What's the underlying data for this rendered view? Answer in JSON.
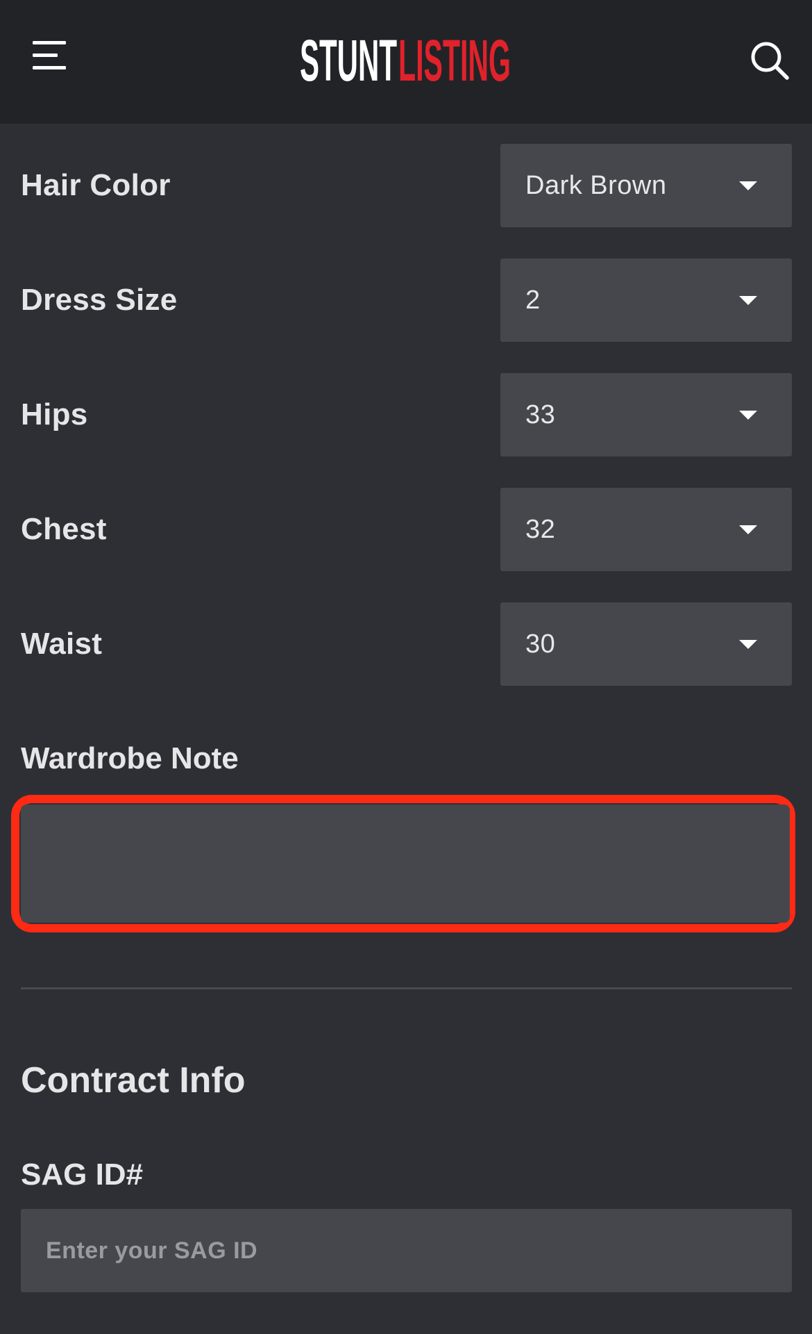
{
  "header": {
    "logo_text_white": "STUNT",
    "logo_text_red": "LISTING",
    "menu_icon": "hamburger-icon",
    "search_icon": "search-icon",
    "colors": {
      "header_bg": "#222327",
      "logo_red": "#e0222b"
    }
  },
  "form": {
    "rows": [
      {
        "label": "Hair Color",
        "value": "Dark Brown"
      },
      {
        "label": "Dress Size",
        "value": "2"
      },
      {
        "label": "Hips",
        "value": "33"
      },
      {
        "label": "Chest",
        "value": "32"
      },
      {
        "label": "Waist",
        "value": "30"
      }
    ],
    "wardrobe_note": {
      "label": "Wardrobe Note",
      "value": ""
    },
    "contract_section": {
      "heading": "Contract Info",
      "sag_label": "SAG ID#",
      "sag_placeholder": "Enter your SAG ID"
    }
  },
  "colors": {
    "page_bg": "#2e2f34",
    "field_bg": "#46474c",
    "highlight": "#ff2a14"
  }
}
